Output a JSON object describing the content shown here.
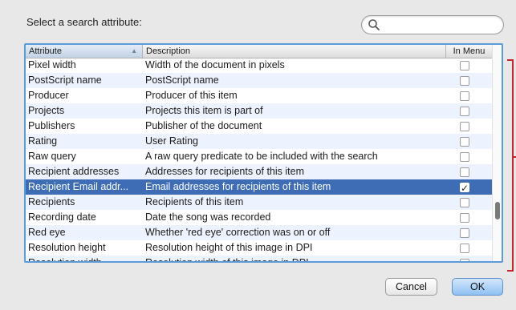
{
  "dialog": {
    "prompt": "Select a search attribute:",
    "search": {
      "value": "",
      "placeholder": ""
    }
  },
  "table": {
    "columns": {
      "attribute": "Attribute",
      "description": "Description",
      "in_menu": "In Menu"
    },
    "sort_column": "Attribute",
    "rows": [
      {
        "attribute": "Pixel width",
        "description": "Width of the document in pixels",
        "in_menu": false
      },
      {
        "attribute": "PostScript name",
        "description": "PostScript name",
        "in_menu": false
      },
      {
        "attribute": "Producer",
        "description": "Producer of this item",
        "in_menu": false
      },
      {
        "attribute": "Projects",
        "description": "Projects this item is part of",
        "in_menu": false
      },
      {
        "attribute": "Publishers",
        "description": "Publisher of the document",
        "in_menu": false
      },
      {
        "attribute": "Rating",
        "description": "User Rating",
        "in_menu": false
      },
      {
        "attribute": "Raw query",
        "description": "A raw query predicate to be included with the search",
        "in_menu": false
      },
      {
        "attribute": "Recipient addresses",
        "description": "Addresses for recipients of this item",
        "in_menu": false
      },
      {
        "attribute": "Recipient Email addr...",
        "description": "Email addresses for recipients of this item",
        "in_menu": true,
        "selected": true
      },
      {
        "attribute": "Recipients",
        "description": "Recipients of this item",
        "in_menu": false
      },
      {
        "attribute": "Recording date",
        "description": "Date the song was recorded",
        "in_menu": false
      },
      {
        "attribute": "Red eye",
        "description": "Whether 'red eye' correction was on or off",
        "in_menu": false
      },
      {
        "attribute": "Resolution height",
        "description": "Resolution height of this image in DPI",
        "in_menu": false
      },
      {
        "attribute": "Resolution width",
        "description": "Resolution width of this image in DPI",
        "in_menu": false
      }
    ]
  },
  "buttons": {
    "cancel": "Cancel",
    "ok": "OK"
  },
  "colors": {
    "selection": "#3e6db5",
    "alt_row": "#edf3fe",
    "focus_ring": "#5b9bd8",
    "annotation": "#c0272d"
  }
}
